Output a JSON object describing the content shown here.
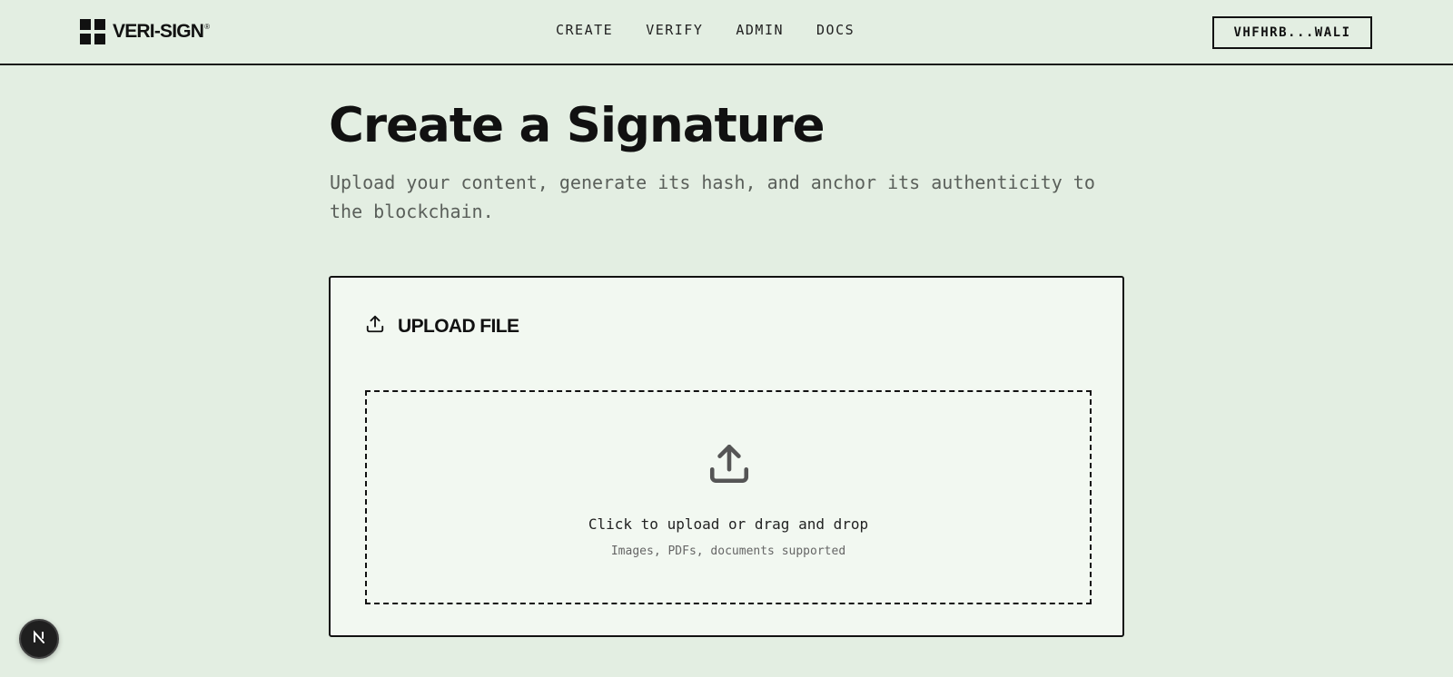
{
  "brand": {
    "name": "VERI-SIGN",
    "mark": "®"
  },
  "nav": {
    "items": [
      {
        "label": "CREATE"
      },
      {
        "label": "VERIFY"
      },
      {
        "label": "ADMIN"
      },
      {
        "label": "DOCS"
      }
    ]
  },
  "wallet": {
    "label": "VHFHRB...WALI"
  },
  "page": {
    "title": "Create a Signature",
    "subtitle": "Upload your content, generate its hash, and anchor its authenticity to the blockchain."
  },
  "upload": {
    "heading": "UPLOAD FILE",
    "heading_icon": "upload-icon",
    "dropzone_icon": "upload-icon",
    "dropzone_primary": "Click to upload or drag and drop",
    "dropzone_secondary": "Images, PDFs, documents supported"
  },
  "dev_badge": {
    "icon": "nextjs-icon"
  },
  "colors": {
    "background": "#e3eee2",
    "card": "#f2f8f1",
    "ink": "#111111",
    "muted": "#5a5f5a"
  }
}
